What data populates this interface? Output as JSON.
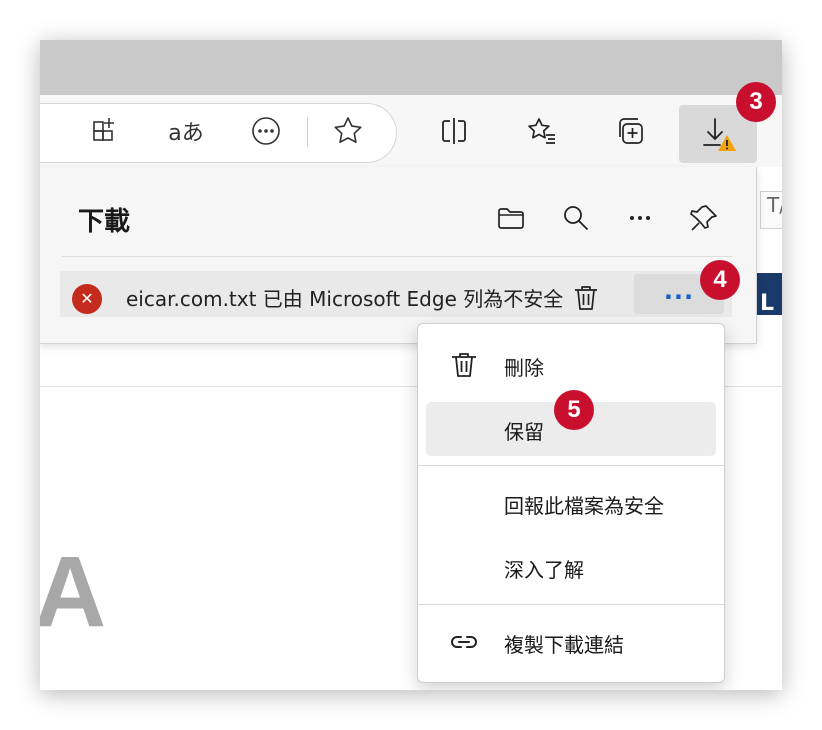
{
  "toolbar": {
    "icons": [
      "apps-grid-icon",
      "read-aloud-icon",
      "more-circle-icon",
      "favorite-star-icon",
      "split-screen-icon",
      "favorites-list-icon",
      "collections-icon",
      "downloads-warning-icon"
    ],
    "read_aloud_glyph": "aあ"
  },
  "page": {
    "header_fragment": "T/",
    "banner_fragment": "L",
    "heading_fragment": "A"
  },
  "downloads_panel": {
    "title": "下載",
    "icons": [
      "folder-icon",
      "search-icon",
      "more-icon",
      "pin-icon"
    ],
    "item": {
      "status_glyph": "✕",
      "text": "eicar.com.txt 已由 Microsoft Edge 列為不安全",
      "more_label": "..."
    }
  },
  "context_menu": {
    "items": [
      {
        "label": "刪除",
        "icon": "trash-icon"
      },
      {
        "label": "保留",
        "icon": ""
      },
      {
        "label": "回報此檔案為安全",
        "icon": ""
      },
      {
        "label": "深入了解",
        "icon": ""
      },
      {
        "label": "複製下載連結",
        "icon": "link-icon"
      }
    ]
  },
  "callouts": [
    "3",
    "4",
    "5"
  ],
  "colors": {
    "accent_blue": "#1a5fc9",
    "error_red": "#c42b1c",
    "callout_red": "#c8102e",
    "warning_orange": "#f0a30a",
    "banner_navy": "#1a3a6c"
  }
}
